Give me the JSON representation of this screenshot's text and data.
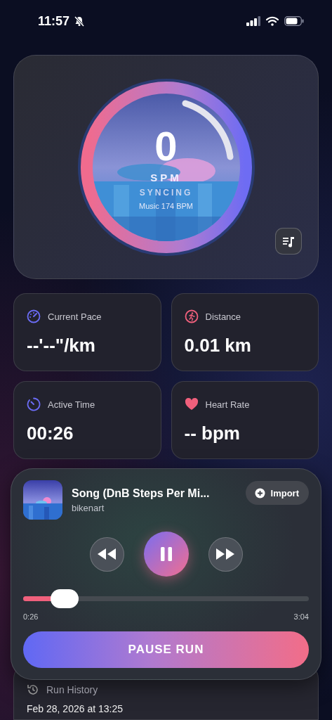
{
  "status_bar": {
    "time": "11:57",
    "silent": true
  },
  "cadence": {
    "value": "0",
    "unit": "SPM",
    "state": "SYNCING",
    "music": "Music 174 BPM"
  },
  "stats": [
    {
      "kind": "pace",
      "label": "Current Pace",
      "value": "--'--\"/km"
    },
    {
      "kind": "distance",
      "label": "Distance",
      "value": "0.01 km"
    },
    {
      "kind": "time",
      "label": "Active Time",
      "value": "00:26"
    },
    {
      "kind": "heart",
      "label": "Heart Rate",
      "value": "-- bpm"
    }
  ],
  "player": {
    "title": "Song (DnB Steps Per Mi...",
    "artist": "bikenart",
    "import_label": "Import",
    "playing": true,
    "level": 0.14,
    "elapsed": "0:26",
    "duration": "3:04",
    "action": "PAUSE RUN"
  },
  "history": {
    "title": "Run History",
    "entries": [
      "Feb 28, 2026 at 13:25"
    ]
  }
}
